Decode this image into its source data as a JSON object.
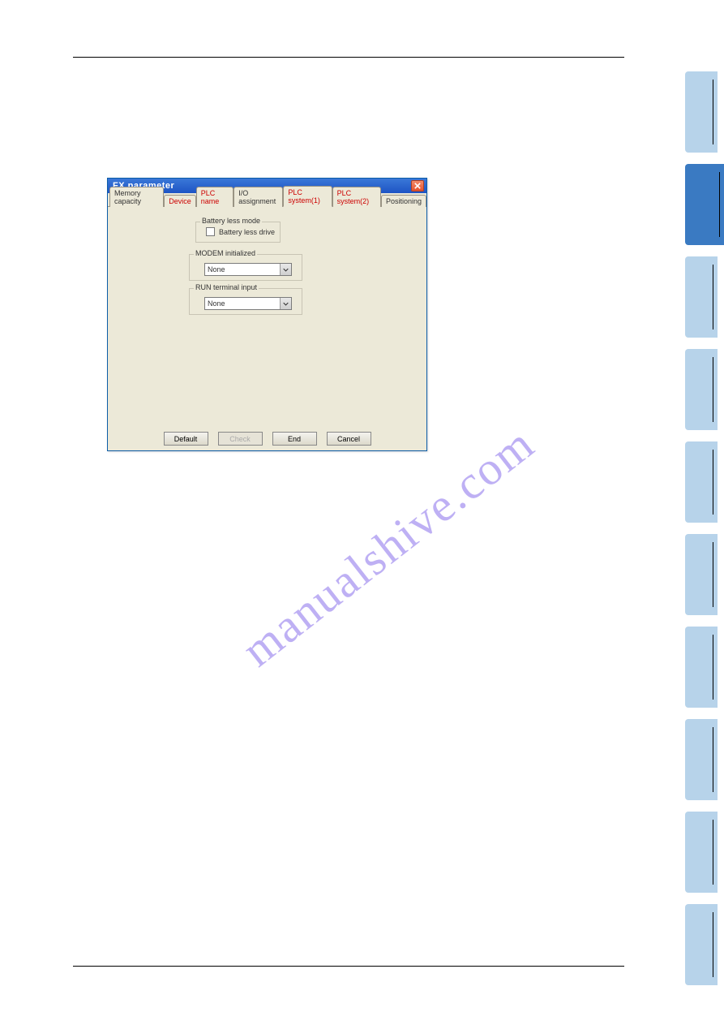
{
  "dialog": {
    "title": "FX parameter",
    "tabs": [
      {
        "label": "Memory capacity",
        "color": "normal"
      },
      {
        "label": "Device",
        "color": "red"
      },
      {
        "label": "PLC name",
        "color": "red"
      },
      {
        "label": "I/O assignment",
        "color": "normal"
      },
      {
        "label": "PLC system(1)",
        "color": "red",
        "active": true
      },
      {
        "label": "PLC system(2)",
        "color": "red"
      },
      {
        "label": "Positioning",
        "color": "normal"
      }
    ],
    "groups": {
      "battery": {
        "legend": "Battery less mode",
        "checkbox_label": "Battery less drive",
        "checked": false
      },
      "modem": {
        "legend": "MODEM initialized",
        "value": "None"
      },
      "run": {
        "legend": "RUN terminal input",
        "value": "None"
      }
    },
    "buttons": {
      "default": "Default",
      "check": "Check",
      "end": "End",
      "cancel": "Cancel"
    }
  },
  "watermark": "manualshive.com"
}
